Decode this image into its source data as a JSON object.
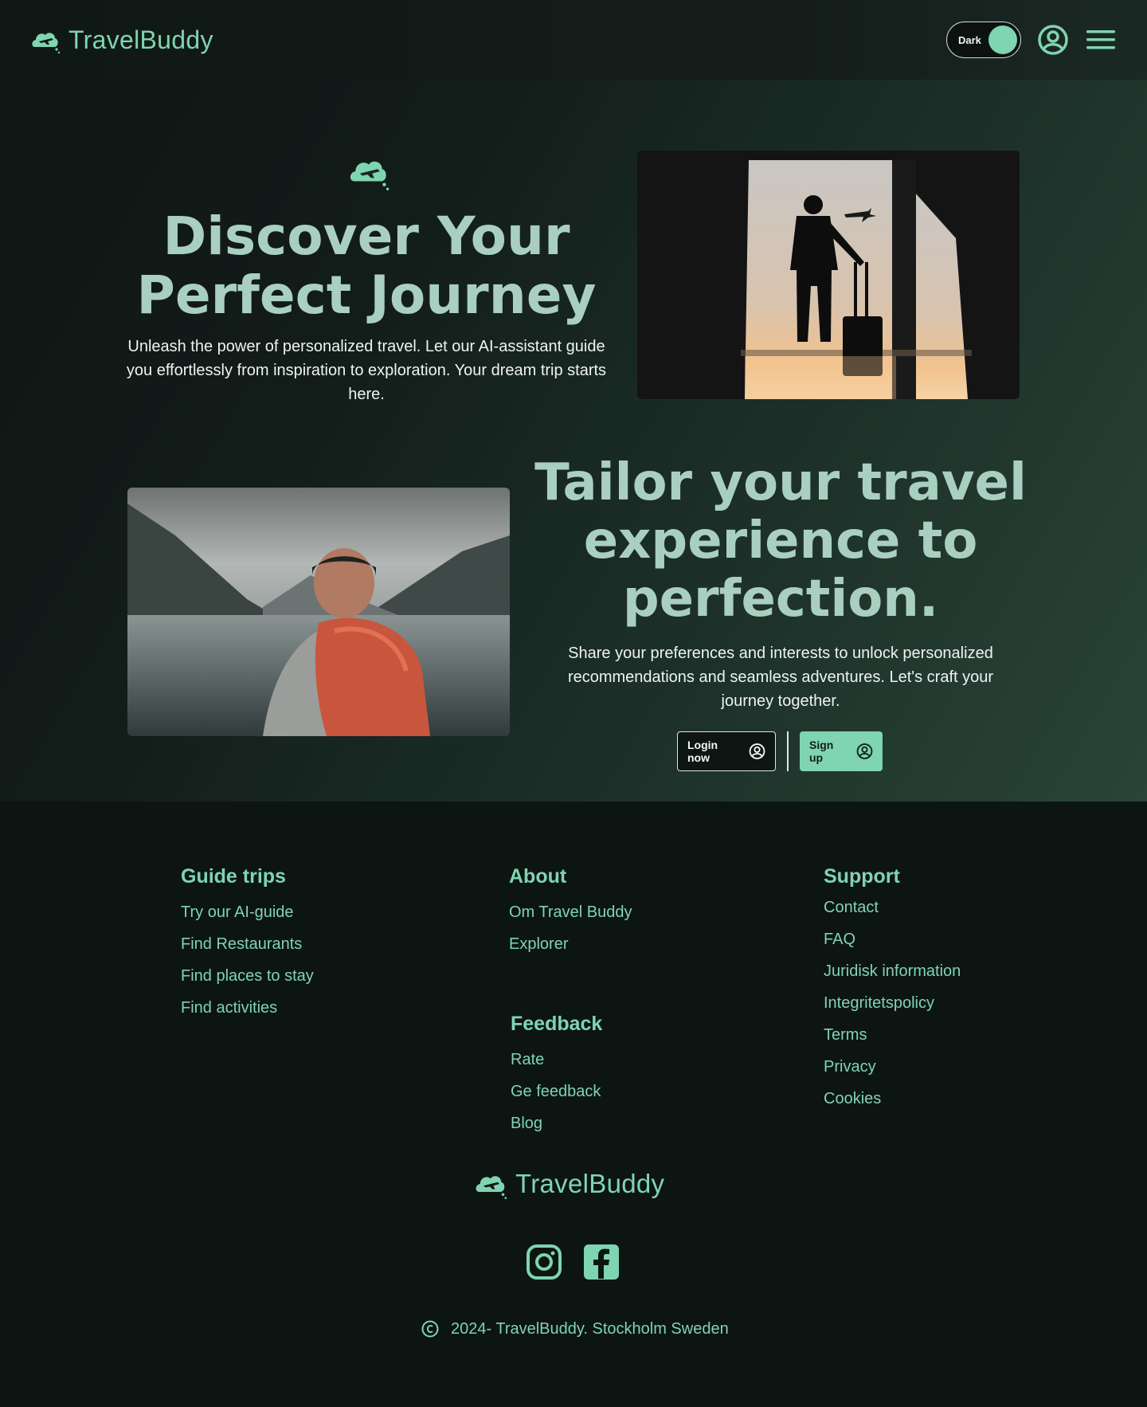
{
  "header": {
    "brand": "TravelBuddy",
    "theme_toggle_label": "Dark"
  },
  "hero": {
    "title": "Discover Your Perfect Journey",
    "text": "Unleash the power of personalized travel. Let our AI-assistant guide you effortlessly from inspiration to exploration. Your dream trip starts here."
  },
  "tailor": {
    "title": "Tailor your travel experience to perfection.",
    "text": "Share your preferences and interests to unlock personalized recommendations and seamless adventures. Let's craft your journey together.",
    "login_label": "Login now",
    "signup_label": "Sign up"
  },
  "footer": {
    "guide": {
      "heading": "Guide trips",
      "links": [
        "Try our AI-guide",
        "Find Restaurants",
        "Find places to stay",
        "Find activities"
      ]
    },
    "about": {
      "heading": "About",
      "links": [
        "Om Travel Buddy",
        "Explorer"
      ]
    },
    "feedback": {
      "heading": "Feedback",
      "links": [
        "Rate",
        "Ge feedback",
        "Blog"
      ]
    },
    "support": {
      "heading": "Support",
      "links": [
        "Contact",
        "FAQ",
        "Juridisk information",
        "Integritetspolicy",
        "Terms",
        "Privacy",
        "Cookies"
      ]
    },
    "brand": "TravelBuddy",
    "copyright": "2024- TravelBuddy. Stockholm Sweden"
  },
  "colors": {
    "accent": "#7fd4b1",
    "background": "#0e1614",
    "heading": "#a9cfc1"
  },
  "icons": [
    "cloud-plane-logo-icon",
    "user-circle-icon",
    "hamburger-menu-icon",
    "instagram-icon",
    "facebook-icon",
    "copyright-icon"
  ]
}
